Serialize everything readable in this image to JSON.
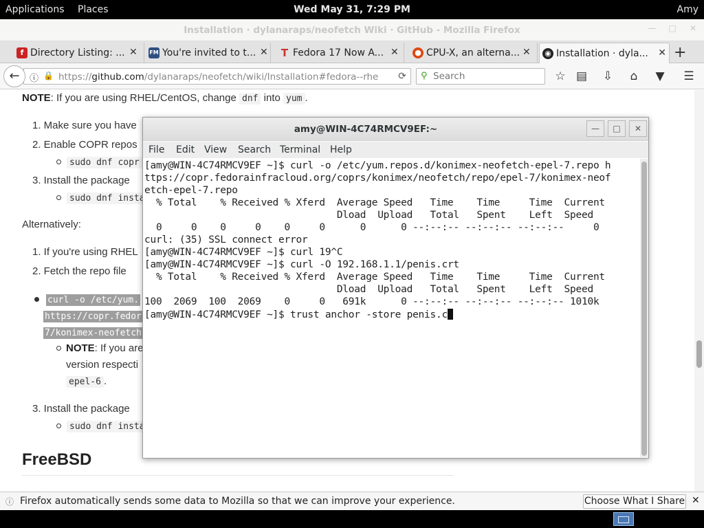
{
  "topbar": {
    "applications": "Applications",
    "places": "Places",
    "clock": "Wed May 31,  7:29 PM",
    "user": "Amy"
  },
  "firefox": {
    "window_title": "Installation · dylanaraps/neofetch Wiki · GitHub - Mozilla Firefox",
    "tabs": [
      {
        "label": "Directory Listing: ...",
        "icon": "fedora-icon",
        "color": "#cc2222"
      },
      {
        "label": "You're invited to t...",
        "icon": "fm-icon",
        "color": "#2f4f7f"
      },
      {
        "label": "Fedora 17 Now A...",
        "icon": "t-icon",
        "color": "#cc3333"
      },
      {
        "label": "CPU-X, an alterna...",
        "icon": "ubuntu-icon",
        "color": "#dd4814"
      },
      {
        "label": "Installation · dyla...",
        "icon": "github-icon",
        "color": "#222222"
      }
    ],
    "url_prefix": "https://",
    "url_host": "github.com",
    "url_path": "/dylanaraps/neofetch/wiki/Installation#fedora--rhe",
    "search_placeholder": "Search"
  },
  "page": {
    "note_label": "NOTE",
    "note_text": ": If you are using RHEL/CentOS, change ",
    "note_code1": "dnf",
    "note_into": " into ",
    "note_code2": "yum",
    "note_end": ".",
    "step1": "1. Make sure you have",
    "step2": "2. Enable COPR repos",
    "step2_code": "sudo dnf copr",
    "step3": "3. Install the package",
    "step3_code": "sudo dnf insta",
    "alternatively": "Alternatively:",
    "alt1": "1. If you're using RHEL",
    "alt2": "2. Fetch the repo file",
    "alt_code1": "curl -o /etc/yum.",
    "alt_code2": "https://copr.fedor",
    "alt_code3": "7/konimex-neofetch",
    "alt_note_label": "NOTE",
    "alt_note_text": ": If you are",
    "alt_note_line2": "version respecti",
    "alt_note_code": "epel-6",
    "alt_note_dot": ".",
    "alt3": "3. Install the package",
    "alt3_code": "sudo dnf insta",
    "freebsd": "FreeBSD"
  },
  "terminal": {
    "title": "amy@WIN-4C74RMCV9EF:~",
    "menu": [
      "File",
      "Edit",
      "View",
      "Search",
      "Terminal",
      "Help"
    ],
    "lines": [
      "[amy@WIN-4C74RMCV9EF ~]$ curl -o /etc/yum.repos.d/konimex-neofetch-epel-7.repo h",
      "ttps://copr.fedorainfracloud.org/coprs/konimex/neofetch/repo/epel-7/konimex-neof",
      "etch-epel-7.repo",
      "  % Total    % Received % Xferd  Average Speed   Time    Time     Time  Current",
      "                                 Dload  Upload   Total   Spent    Left  Speed",
      "  0     0    0     0    0     0      0      0 --:--:-- --:--:-- --:--:--     0",
      "curl: (35) SSL connect error",
      "[amy@WIN-4C74RMCV9EF ~]$ curl 19^C",
      "[amy@WIN-4C74RMCV9EF ~]$ curl -O 192.168.1.1/penis.crt",
      "  % Total    % Received % Xferd  Average Speed   Time    Time     Time  Current",
      "                                 Dload  Upload   Total   Spent    Left  Speed",
      "100  2069  100  2069    0     0   691k      0 --:--:-- --:--:-- --:--:-- 1010k"
    ],
    "prompt_line": "[amy@WIN-4C74RMCV9EF ~]$ trust anchor -store penis.c"
  },
  "notification": {
    "text": "Firefox automatically sends some data to Mozilla so that we can improve your experience.",
    "button": "Choose What I Share"
  }
}
